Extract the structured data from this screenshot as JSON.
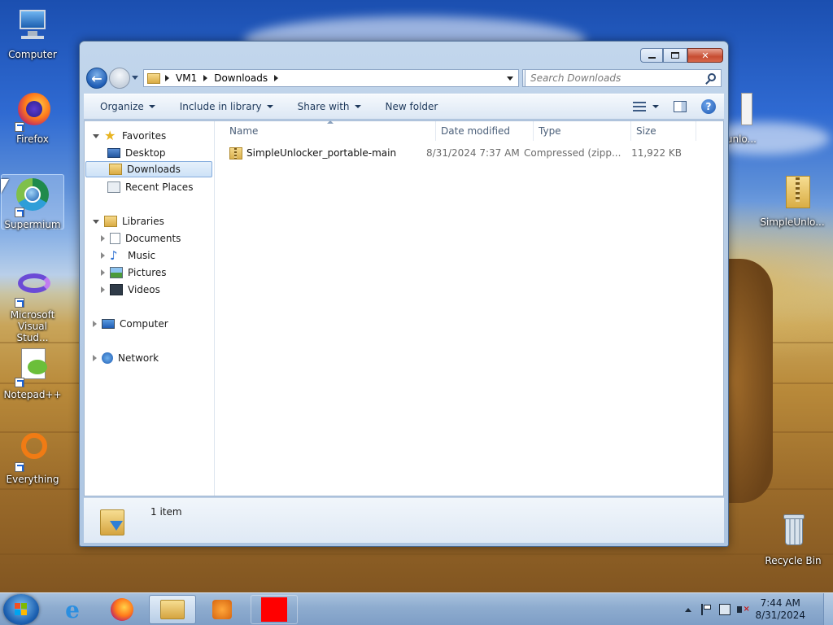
{
  "desktop": {
    "icons": [
      {
        "label": "Computer",
        "icon": "computer-icon"
      },
      {
        "label": "Firefox",
        "icon": "firefox-icon"
      },
      {
        "label": "Supermium",
        "icon": "supermium-icon"
      },
      {
        "label": "Microsoft Visual Stud...",
        "icon": "visual-studio-icon"
      },
      {
        "label": "Notepad++",
        "icon": "notepadpp-icon"
      },
      {
        "label": "Everything",
        "icon": "everything-icon"
      },
      {
        "label": "unlo...",
        "icon": "file-icon"
      },
      {
        "label": "SimpleUnlo...",
        "icon": "zip-folder-icon"
      },
      {
        "label": "Recycle Bin",
        "icon": "recycle-bin-icon"
      }
    ]
  },
  "window": {
    "address": [
      "VM1",
      "Downloads"
    ],
    "search_placeholder": "Search Downloads",
    "toolbar": {
      "organize": "Organize",
      "include": "Include in library",
      "share": "Share with",
      "new_folder": "New folder"
    },
    "nav": {
      "favorites": "Favorites",
      "desktop": "Desktop",
      "downloads": "Downloads",
      "recent": "Recent Places",
      "libraries": "Libraries",
      "documents": "Documents",
      "music": "Music",
      "pictures": "Pictures",
      "videos": "Videos",
      "computer": "Computer",
      "network": "Network"
    },
    "columns": {
      "name": "Name",
      "date": "Date modified",
      "type": "Type",
      "size": "Size"
    },
    "files": [
      {
        "name": "SimpleUnlocker_portable-main",
        "date": "8/31/2024 7:37 AM",
        "type": "Compressed (zipp...",
        "size": "11,922 KB"
      }
    ],
    "status": "1 item"
  },
  "taskbar": {
    "time": "7:44 AM",
    "date": "8/31/2024"
  }
}
